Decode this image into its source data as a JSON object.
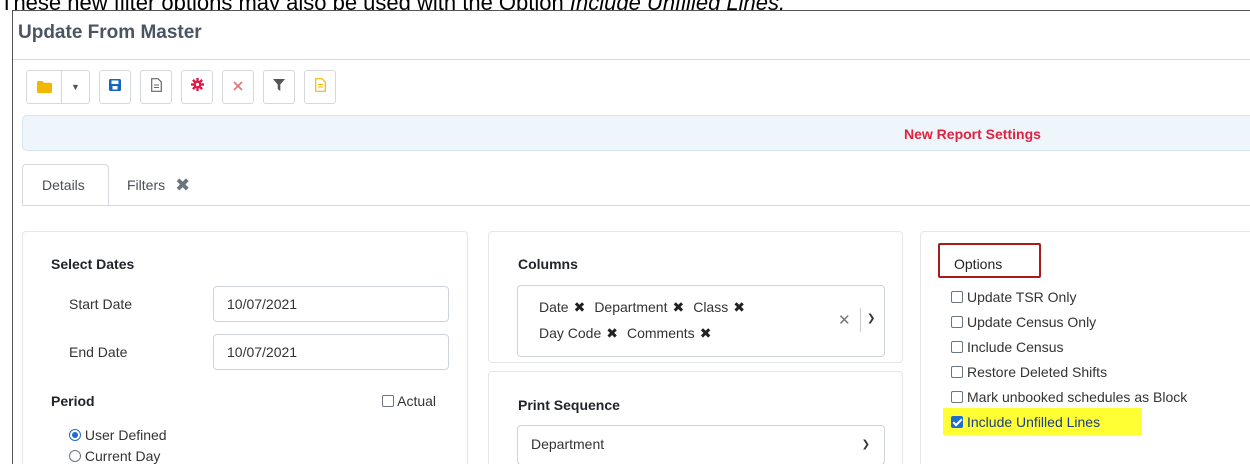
{
  "caption": {
    "prefix": "These new filter options may also be used with the Option ",
    "emphasis": "Include Unfilled Lines."
  },
  "window": {
    "title": "Update From Master"
  },
  "toolbar": {
    "buttons": [
      {
        "name": "folder-icon",
        "color": "#f2b705"
      },
      {
        "name": "save-icon",
        "color": "#1565c0"
      },
      {
        "name": "document-icon",
        "color": "#666666"
      },
      {
        "name": "gear-icon",
        "color": "#d81b4a"
      },
      {
        "name": "close-icon",
        "color": "#e57373"
      },
      {
        "name": "filter-icon",
        "color": "#555555"
      },
      {
        "name": "report-icon",
        "color": "#f2b705"
      }
    ]
  },
  "banner": {
    "text": "New Report Settings",
    "color": "#e0223f"
  },
  "tabs": [
    {
      "label": "Details",
      "active": true
    },
    {
      "label": "Filters",
      "active": false
    }
  ],
  "dates": {
    "title": "Select Dates",
    "start_label": "Start Date",
    "start_value": "10/07/2021",
    "end_label": "End Date",
    "end_value": "10/07/2021",
    "period_label": "Period",
    "actual_label": "Actual",
    "actual_checked": false,
    "period_options": [
      {
        "label": "User Defined",
        "selected": true
      },
      {
        "label": "Current Day",
        "selected": false
      }
    ]
  },
  "columns": {
    "title": "Columns",
    "chips": [
      "Date",
      "Department",
      "Class",
      "Day Code",
      "Comments"
    ]
  },
  "print_sequence": {
    "title": "Print Sequence",
    "value": "Department"
  },
  "options": {
    "title": "Options",
    "items": [
      {
        "label": "Update TSR Only",
        "checked": false
      },
      {
        "label": "Update Census Only",
        "checked": false
      },
      {
        "label": "Include Census",
        "checked": false
      },
      {
        "label": "Restore Deleted Shifts",
        "checked": false
      },
      {
        "label": "Mark unbooked schedules as Block",
        "checked": false
      },
      {
        "label": "Include Unfilled Lines",
        "checked": true
      }
    ],
    "highlight_color": "#ffff33",
    "title_box_color": "#a61c1c"
  }
}
